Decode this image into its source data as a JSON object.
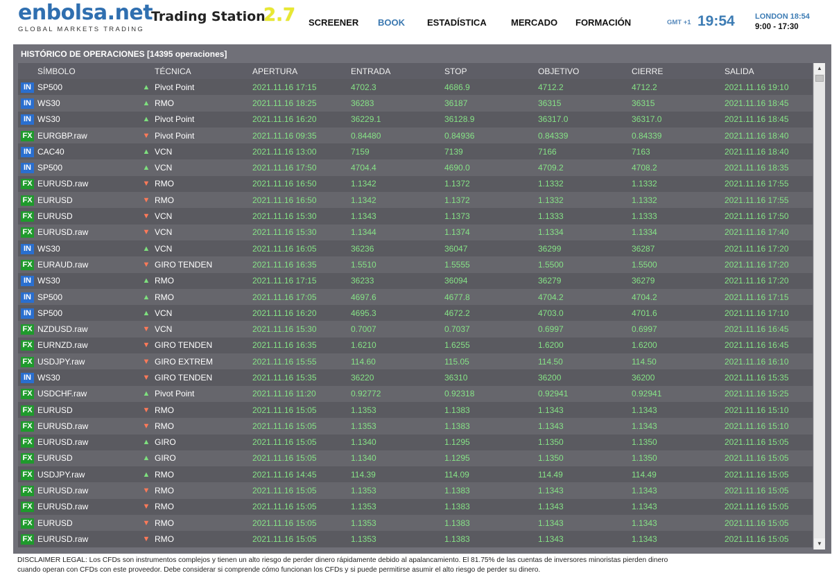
{
  "header": {
    "logo": "enbolsa.net",
    "tagline": "GLOBAL MARKETS TRADING",
    "app_name": "Trading Station",
    "app_version": "2.7",
    "nav": [
      "SCREENER",
      "BOOK",
      "ESTADÍSTICA",
      "MERCADO",
      "FORMACIÓN"
    ],
    "active_nav": "BOOK",
    "gmt": "GMT +1",
    "time": "19:54",
    "london_time": "LONDON 18:54",
    "hours": "9:00 - 17:30"
  },
  "panel": {
    "title": "HISTÓRICO DE OPERACIONES [14395 operaciones]"
  },
  "table": {
    "columns": [
      "SÍMBOLO",
      "TÉCNICA",
      "APERTURA",
      "ENTRADA",
      "STOP",
      "OBJETIVO",
      "CIERRE",
      "SALIDA"
    ],
    "rows": [
      {
        "type": "IN",
        "symbol": "SP500",
        "dir": "up",
        "tech": "Pivot Point",
        "open": "2021.11.16 17:15",
        "entry": "4702.3",
        "stop": "4686.9",
        "target": "4712.2",
        "close": "4712.2",
        "exit": "2021.11.16 19:10"
      },
      {
        "type": "IN",
        "symbol": "WS30",
        "dir": "up",
        "tech": "RMO",
        "open": "2021.11.16 18:25",
        "entry": "36283",
        "stop": "36187",
        "target": "36315",
        "close": "36315",
        "exit": "2021.11.16 18:45"
      },
      {
        "type": "IN",
        "symbol": "WS30",
        "dir": "up",
        "tech": "Pivot Point",
        "open": "2021.11.16 16:20",
        "entry": "36229.1",
        "stop": "36128.9",
        "target": "36317.0",
        "close": "36317.0",
        "exit": "2021.11.16 18:45"
      },
      {
        "type": "FX",
        "symbol": "EURGBP.raw",
        "dir": "down",
        "tech": "Pivot Point",
        "open": "2021.11.16 09:35",
        "entry": "0.84480",
        "stop": "0.84936",
        "target": "0.84339",
        "close": "0.84339",
        "exit": "2021.11.16 18:40"
      },
      {
        "type": "IN",
        "symbol": "CAC40",
        "dir": "up",
        "tech": "VCN",
        "open": "2021.11.16 13:00",
        "entry": "7159",
        "stop": "7139",
        "target": "7166",
        "close": "7163",
        "exit": "2021.11.16 18:40"
      },
      {
        "type": "IN",
        "symbol": "SP500",
        "dir": "up",
        "tech": "VCN",
        "open": "2021.11.16 17:50",
        "entry": "4704.4",
        "stop": "4690.0",
        "target": "4709.2",
        "close": "4708.2",
        "exit": "2021.11.16 18:35"
      },
      {
        "type": "FX",
        "symbol": "EURUSD.raw",
        "dir": "down",
        "tech": "RMO",
        "open": "2021.11.16 16:50",
        "entry": "1.1342",
        "stop": "1.1372",
        "target": "1.1332",
        "close": "1.1332",
        "exit": "2021.11.16 17:55"
      },
      {
        "type": "FX",
        "symbol": "EURUSD",
        "dir": "down",
        "tech": "RMO",
        "open": "2021.11.16 16:50",
        "entry": "1.1342",
        "stop": "1.1372",
        "target": "1.1332",
        "close": "1.1332",
        "exit": "2021.11.16 17:55"
      },
      {
        "type": "FX",
        "symbol": "EURUSD",
        "dir": "down",
        "tech": "VCN",
        "open": "2021.11.16 15:30",
        "entry": "1.1343",
        "stop": "1.1373",
        "target": "1.1333",
        "close": "1.1333",
        "exit": "2021.11.16 17:50"
      },
      {
        "type": "FX",
        "symbol": "EURUSD.raw",
        "dir": "down",
        "tech": "VCN",
        "open": "2021.11.16 15:30",
        "entry": "1.1344",
        "stop": "1.1374",
        "target": "1.1334",
        "close": "1.1334",
        "exit": "2021.11.16 17:40"
      },
      {
        "type": "IN",
        "symbol": "WS30",
        "dir": "up",
        "tech": "VCN",
        "open": "2021.11.16 16:05",
        "entry": "36236",
        "stop": "36047",
        "target": "36299",
        "close": "36287",
        "exit": "2021.11.16 17:20"
      },
      {
        "type": "FX",
        "symbol": "EURAUD.raw",
        "dir": "down",
        "tech": "GIRO TENDEN",
        "open": "2021.11.16 16:35",
        "entry": "1.5510",
        "stop": "1.5555",
        "target": "1.5500",
        "close": "1.5500",
        "exit": "2021.11.16 17:20"
      },
      {
        "type": "IN",
        "symbol": "WS30",
        "dir": "up",
        "tech": "RMO",
        "open": "2021.11.16 17:15",
        "entry": "36233",
        "stop": "36094",
        "target": "36279",
        "close": "36279",
        "exit": "2021.11.16 17:20"
      },
      {
        "type": "IN",
        "symbol": "SP500",
        "dir": "up",
        "tech": "RMO",
        "open": "2021.11.16 17:05",
        "entry": "4697.6",
        "stop": "4677.8",
        "target": "4704.2",
        "close": "4704.2",
        "exit": "2021.11.16 17:15"
      },
      {
        "type": "IN",
        "symbol": "SP500",
        "dir": "up",
        "tech": "VCN",
        "open": "2021.11.16 16:20",
        "entry": "4695.3",
        "stop": "4672.2",
        "target": "4703.0",
        "close": "4701.6",
        "exit": "2021.11.16 17:10"
      },
      {
        "type": "FX",
        "symbol": "NZDUSD.raw",
        "dir": "down",
        "tech": "VCN",
        "open": "2021.11.16 15:30",
        "entry": "0.7007",
        "stop": "0.7037",
        "target": "0.6997",
        "close": "0.6997",
        "exit": "2021.11.16 16:45"
      },
      {
        "type": "FX",
        "symbol": "EURNZD.raw",
        "dir": "down",
        "tech": "GIRO TENDEN",
        "open": "2021.11.16 16:35",
        "entry": "1.6210",
        "stop": "1.6255",
        "target": "1.6200",
        "close": "1.6200",
        "exit": "2021.11.16 16:45"
      },
      {
        "type": "FX",
        "symbol": "USDJPY.raw",
        "dir": "down",
        "tech": "GIRO EXTREM",
        "open": "2021.11.16 15:55",
        "entry": "114.60",
        "stop": "115.05",
        "target": "114.50",
        "close": "114.50",
        "exit": "2021.11.16 16:10"
      },
      {
        "type": "IN",
        "symbol": "WS30",
        "dir": "down",
        "tech": "GIRO TENDEN",
        "open": "2021.11.16 15:35",
        "entry": "36220",
        "stop": "36310",
        "target": "36200",
        "close": "36200",
        "exit": "2021.11.16 15:35"
      },
      {
        "type": "FX",
        "symbol": "USDCHF.raw",
        "dir": "up",
        "tech": "Pivot Point",
        "open": "2021.11.16 11:20",
        "entry": "0.92772",
        "stop": "0.92318",
        "target": "0.92941",
        "close": "0.92941",
        "exit": "2021.11.16 15:25"
      },
      {
        "type": "FX",
        "symbol": "EURUSD",
        "dir": "down",
        "tech": "RMO",
        "open": "2021.11.16 15:05",
        "entry": "1.1353",
        "stop": "1.1383",
        "target": "1.1343",
        "close": "1.1343",
        "exit": "2021.11.16 15:10"
      },
      {
        "type": "FX",
        "symbol": "EURUSD.raw",
        "dir": "down",
        "tech": "RMO",
        "open": "2021.11.16 15:05",
        "entry": "1.1353",
        "stop": "1.1383",
        "target": "1.1343",
        "close": "1.1343",
        "exit": "2021.11.16 15:10"
      },
      {
        "type": "FX",
        "symbol": "EURUSD.raw",
        "dir": "up",
        "tech": "GIRO",
        "open": "2021.11.16 15:05",
        "entry": "1.1340",
        "stop": "1.1295",
        "target": "1.1350",
        "close": "1.1350",
        "exit": "2021.11.16 15:05"
      },
      {
        "type": "FX",
        "symbol": "EURUSD",
        "dir": "up",
        "tech": "GIRO",
        "open": "2021.11.16 15:05",
        "entry": "1.1340",
        "stop": "1.1295",
        "target": "1.1350",
        "close": "1.1350",
        "exit": "2021.11.16 15:05"
      },
      {
        "type": "FX",
        "symbol": "USDJPY.raw",
        "dir": "up",
        "tech": "RMO",
        "open": "2021.11.16 14:45",
        "entry": "114.39",
        "stop": "114.09",
        "target": "114.49",
        "close": "114.49",
        "exit": "2021.11.16 15:05"
      },
      {
        "type": "FX",
        "symbol": "EURUSD.raw",
        "dir": "down",
        "tech": "RMO",
        "open": "2021.11.16 15:05",
        "entry": "1.1353",
        "stop": "1.1383",
        "target": "1.1343",
        "close": "1.1343",
        "exit": "2021.11.16 15:05"
      },
      {
        "type": "FX",
        "symbol": "EURUSD.raw",
        "dir": "down",
        "tech": "RMO",
        "open": "2021.11.16 15:05",
        "entry": "1.1353",
        "stop": "1.1383",
        "target": "1.1343",
        "close": "1.1343",
        "exit": "2021.11.16 15:05"
      },
      {
        "type": "FX",
        "symbol": "EURUSD",
        "dir": "down",
        "tech": "RMO",
        "open": "2021.11.16 15:05",
        "entry": "1.1353",
        "stop": "1.1383",
        "target": "1.1343",
        "close": "1.1343",
        "exit": "2021.11.16 15:05"
      },
      {
        "type": "FX",
        "symbol": "EURUSD.raw",
        "dir": "down",
        "tech": "RMO",
        "open": "2021.11.16 15:05",
        "entry": "1.1353",
        "stop": "1.1383",
        "target": "1.1343",
        "close": "1.1343",
        "exit": "2021.11.16 15:05"
      }
    ]
  },
  "disclaimer": "DISCLAIMER LEGAL: Los CFDs son instrumentos complejos y tienen un alto riesgo de perder dinero rápidamente debido al apalancamiento. El 81.75% de las cuentas de inversores minoristas pierden dinero cuando operan con CFDs con este proveedor. Debe considerar si comprende cómo funcionan los CFDs y si puede permitirse asumir el alto riesgo de perder su dinero.",
  "icons": {
    "up": "triangle-up-icon",
    "down": "triangle-down-icon"
  },
  "colors": {
    "in_badge": "#2a6fcf",
    "fx_badge": "#1f9a2c",
    "up_arrow": "#7ee07e",
    "down_arrow": "#ff7a59",
    "values": "#86e386"
  }
}
